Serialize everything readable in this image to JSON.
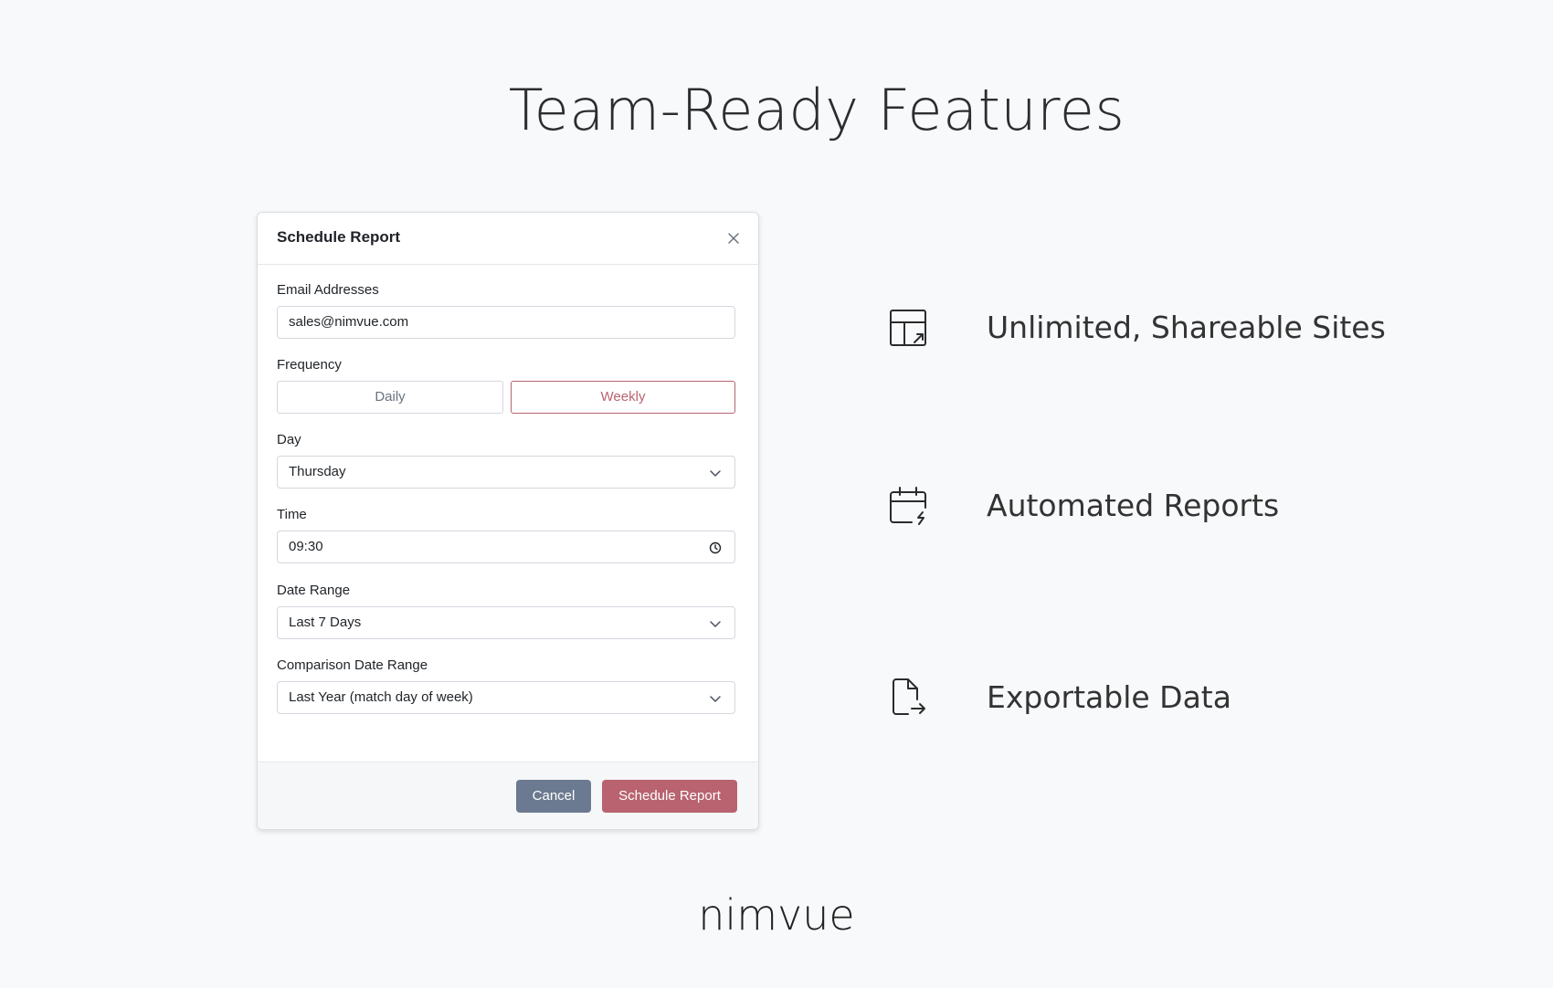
{
  "page": {
    "title": "Team-Ready Features",
    "brand": "nimvue"
  },
  "modal": {
    "title": "Schedule Report",
    "fields": {
      "email_label": "Email Addresses",
      "email_value": "sales@nimvue.com",
      "frequency_label": "Frequency",
      "frequency_options": [
        "Daily",
        "Weekly"
      ],
      "frequency_selected": "Weekly",
      "day_label": "Day",
      "day_value": "Thursday",
      "time_label": "Time",
      "time_value": "09:30",
      "date_range_label": "Date Range",
      "date_range_value": "Last 7 Days",
      "comparison_label": "Comparison Date Range",
      "comparison_value": "Last Year (match day of week)"
    },
    "footer": {
      "cancel_label": "Cancel",
      "submit_label": "Schedule Report"
    }
  },
  "features": [
    {
      "label": "Unlimited, Shareable Sites",
      "icon": "table-share-icon"
    },
    {
      "label": "Automated Reports",
      "icon": "calendar-bolt-icon"
    },
    {
      "label": "Exportable Data",
      "icon": "file-export-icon"
    }
  ],
  "colors": {
    "accent": "#b8636f",
    "secondary": "#6b7a90",
    "background": "#f8f9fb"
  }
}
